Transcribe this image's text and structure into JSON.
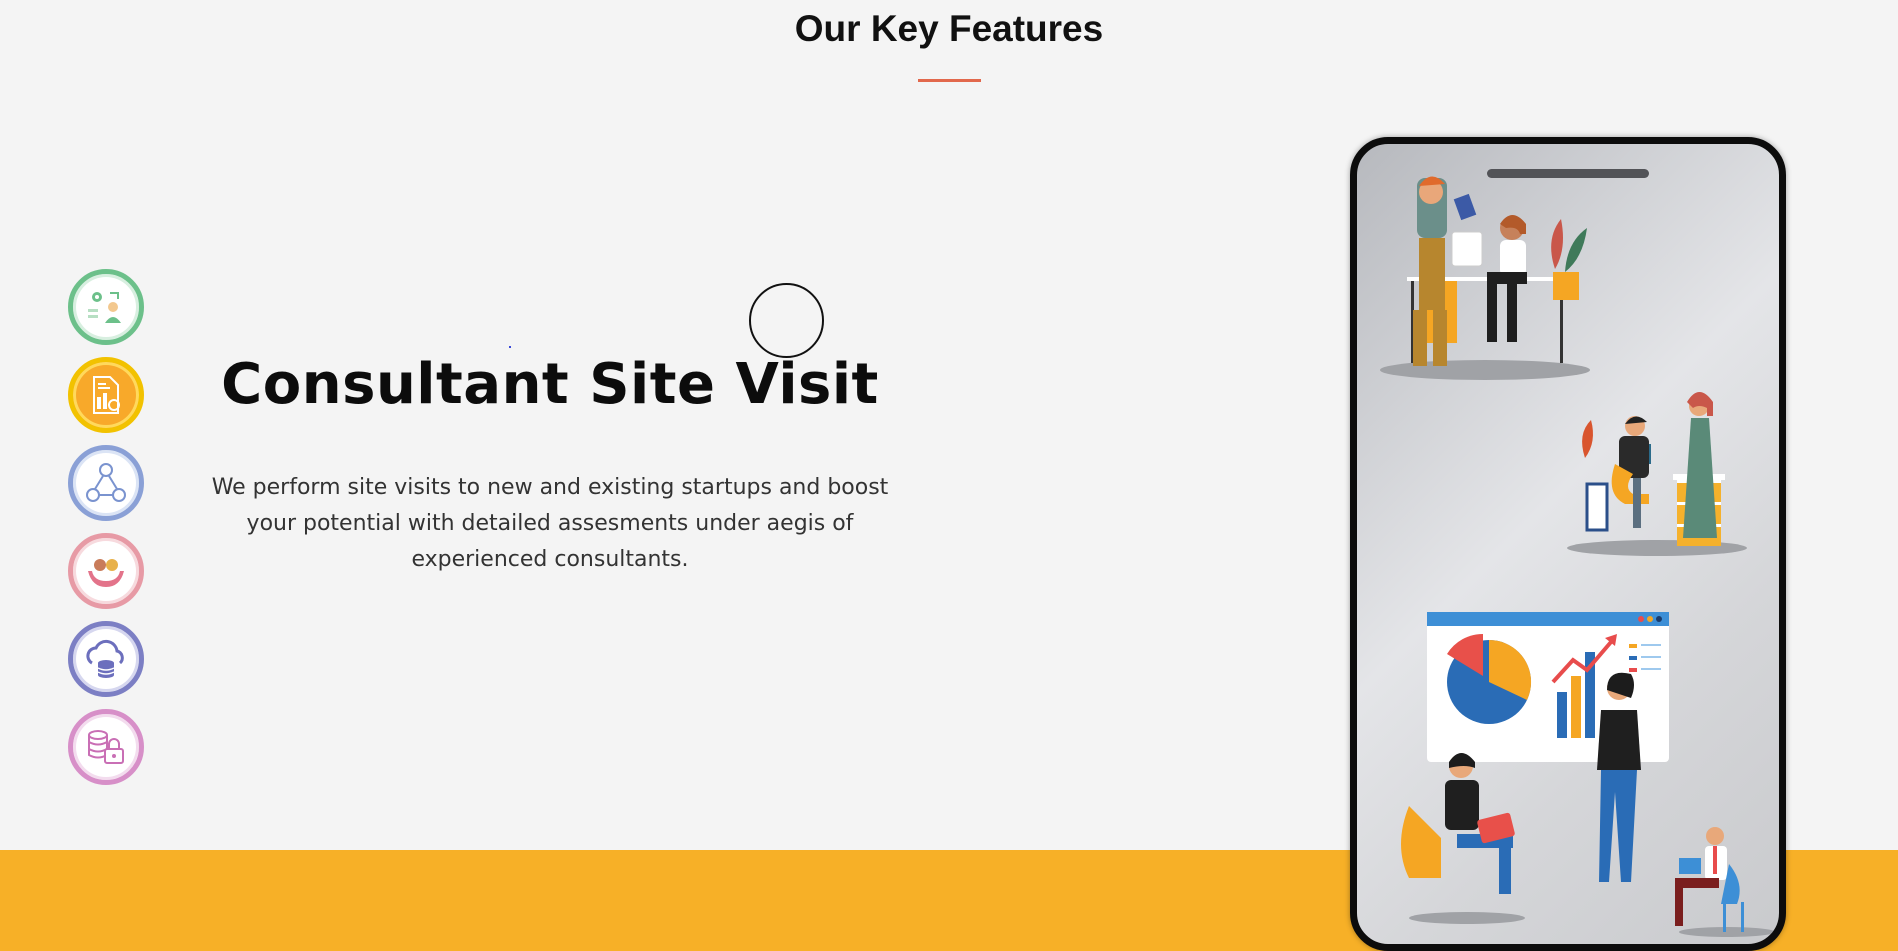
{
  "section": {
    "title": "Our Key Features"
  },
  "feature": {
    "heading": "Consultant Site Visit",
    "description": "We perform site visits to new and existing startups and boost your potential with detailed assesments under aegis of experienced consultants."
  },
  "feature_icons": [
    {
      "icon": "consultant-growth-icon",
      "ring_color": "#6cc08a"
    },
    {
      "icon": "document-report-icon",
      "ring_color": "#f2c200"
    },
    {
      "icon": "network-users-icon",
      "ring_color": "#8aa0d6"
    },
    {
      "icon": "helping-hands-icon",
      "ring_color": "#e79aa5"
    },
    {
      "icon": "cloud-database-icon",
      "ring_color": "#7c7fc4"
    },
    {
      "icon": "database-lock-icon",
      "ring_color": "#d78fc8"
    }
  ],
  "colors": {
    "accent_underline": "#e2684c",
    "footer_band": "#f7b027",
    "page_background": "#f4f4f4"
  }
}
